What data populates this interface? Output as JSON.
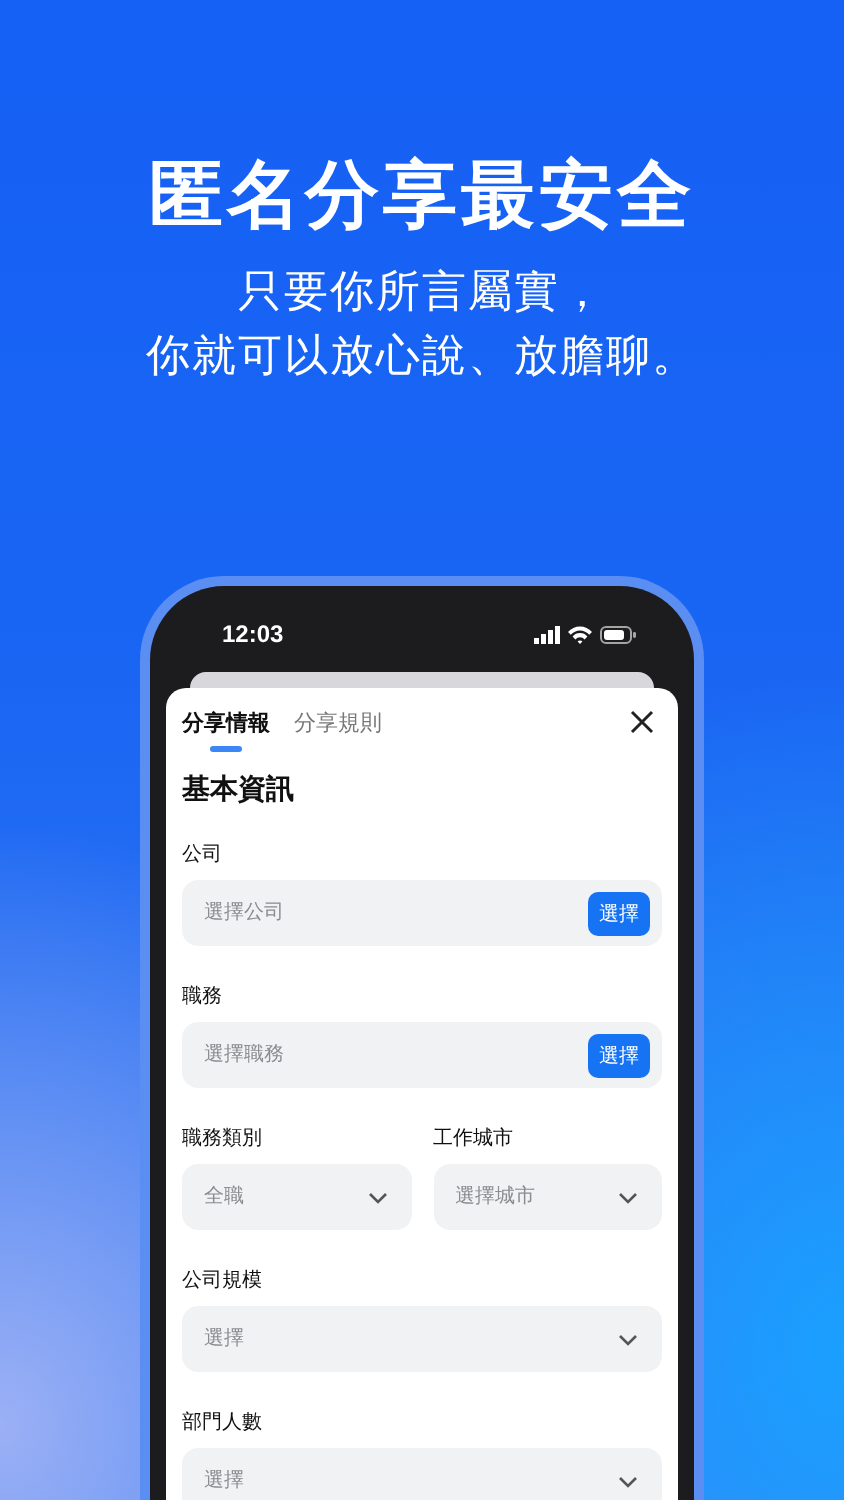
{
  "headline": "匿名分享最安全",
  "subtitle": [
    "只要你所言屬實，",
    "你就可以放心說、放膽聊。"
  ],
  "status_bar": {
    "time": "12:03"
  },
  "tabs": [
    {
      "label": "分享情報",
      "selected": true
    },
    {
      "label": "分享規則",
      "selected": false
    }
  ],
  "section_title": "基本資訊",
  "rows": [
    [
      {
        "label": "公司",
        "placeholder": "選擇公司",
        "kind": "picker",
        "button": "選擇"
      }
    ],
    [
      {
        "label": "職務",
        "placeholder": "選擇職務",
        "kind": "picker",
        "button": "選擇"
      }
    ],
    [
      {
        "label": "職務類別",
        "placeholder": "全職",
        "kind": "dropdown"
      },
      {
        "label": "工作城市",
        "placeholder": "選擇城市",
        "kind": "dropdown"
      }
    ],
    [
      {
        "label": "公司規模",
        "placeholder": "選擇",
        "kind": "dropdown"
      }
    ],
    [
      {
        "label": "部門人數",
        "placeholder": "選擇",
        "kind": "dropdown"
      }
    ]
  ]
}
